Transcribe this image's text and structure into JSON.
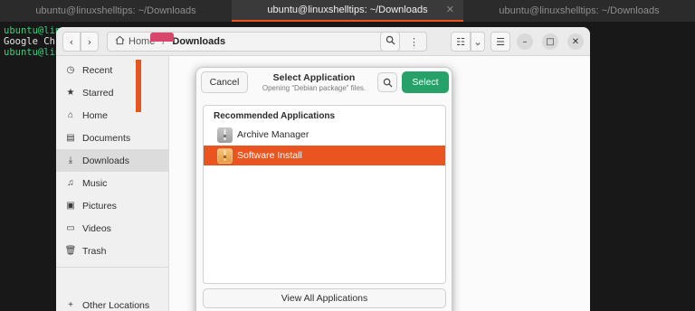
{
  "terminal": {
    "tabs": [
      {
        "title": "ubuntu@linuxshelltips: ~/Downloads",
        "active": false
      },
      {
        "title": "ubuntu@linuxshelltips: ~/Downloads",
        "active": true
      },
      {
        "title": "ubuntu@linuxshelltips: ~/Downloads",
        "active": false
      }
    ],
    "lines": [
      "ubuntu@linu",
      "Google Chr",
      "ubuntu@linu"
    ]
  },
  "file_manager": {
    "path": {
      "home": "Home",
      "current": "Downloads"
    },
    "sidebar": {
      "items": [
        {
          "label": "Recent",
          "icon": "clock-icon"
        },
        {
          "label": "Starred",
          "icon": "star-icon"
        },
        {
          "label": "Home",
          "icon": "home-icon"
        },
        {
          "label": "Documents",
          "icon": "document-icon"
        },
        {
          "label": "Downloads",
          "icon": "download-icon",
          "active": true
        },
        {
          "label": "Music",
          "icon": "music-icon"
        },
        {
          "label": "Pictures",
          "icon": "picture-icon"
        },
        {
          "label": "Videos",
          "icon": "video-icon"
        },
        {
          "label": "Trash",
          "icon": "trash-icon"
        }
      ],
      "other_locations": "Other Locations"
    }
  },
  "dialog": {
    "title": "Select Application",
    "subtitle": "Opening “Debian package” files.",
    "cancel_label": "Cancel",
    "select_label": "Select",
    "section_header": "Recommended Applications",
    "apps": [
      {
        "name": "Archive Manager",
        "selected": false
      },
      {
        "name": "Software Install",
        "selected": true
      }
    ],
    "view_all_label": "View All Applications",
    "accent_color": "#e95420",
    "select_color": "#26a269"
  }
}
